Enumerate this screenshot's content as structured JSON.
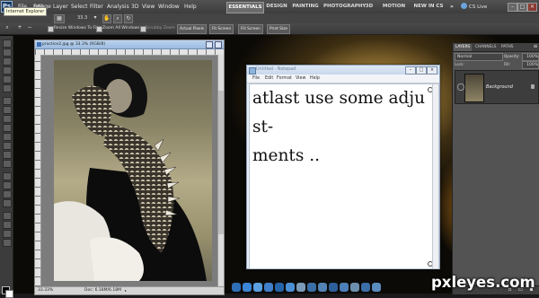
{
  "app": {
    "menus": [
      "File",
      "Edit",
      "Image",
      "Layer",
      "Select",
      "Filter",
      "Analysis",
      "3D",
      "View",
      "Window",
      "Help"
    ],
    "tooltip": "Internet Explorer",
    "zoom_value": "33.3",
    "workspaces": [
      "ESSENTIALS",
      "DESIGN",
      "PAINTING",
      "PHOTOGRAPHY",
      "3D",
      "MOTION",
      "NEW IN CS 5"
    ],
    "cs_live": "CS Live"
  },
  "options_bar": {
    "resize_windows": "Resize Windows To Fit",
    "zoom_all_windows": "Zoom All Windows",
    "scrubby_zoom": "Scrubby Zoom",
    "actual_pixels": "Actual Pixels",
    "fit_screen": "Fit Screen",
    "fill_screen": "Fill Screen",
    "print_size": "Print Size"
  },
  "document": {
    "title": "practice2.jpg @ 33.3% (RGB/8)",
    "zoom": "33.33%",
    "doc_size": "Doc: 6.18M/6.18M"
  },
  "notepad": {
    "title": "Untitled - Notepad",
    "menus": [
      "File",
      "Edit",
      "Format",
      "View",
      "Help"
    ],
    "content": "atlast use some adjust-\nments .."
  },
  "layers_panel": {
    "tabs": [
      "LAYERS",
      "CHANNELS",
      "PATHS"
    ],
    "blend_mode": "Normal",
    "opacity_label": "Opacity:",
    "opacity": "100%",
    "lock_label": "Lock:",
    "fill_label": "Fill:",
    "fill": "100%",
    "layer_name": "Background"
  },
  "watermark": "pxleyes.com",
  "colors": {
    "menubar": "#424242",
    "notepad_frame": "#e7eef7",
    "photoshop_logo": "#1c3a5e"
  }
}
